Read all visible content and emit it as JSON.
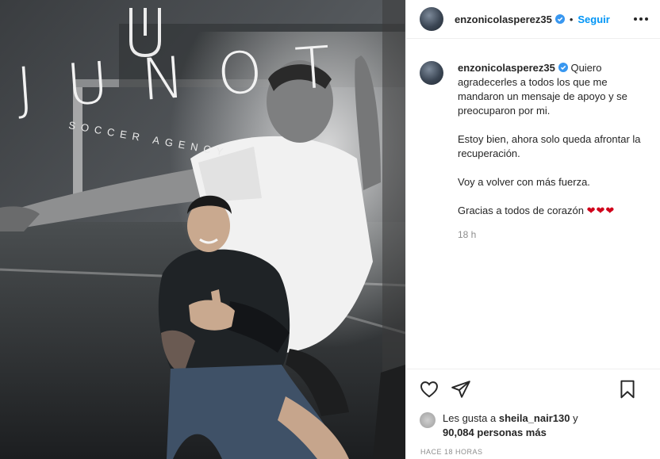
{
  "photo": {
    "logo_letters": "JUNOT",
    "logo_sub": "SOCCER AGENCY"
  },
  "header": {
    "username": "enzonicolasperez35",
    "separator": "•",
    "follow_label": "Seguir"
  },
  "caption": {
    "username": "enzonicolasperez35",
    "paragraphs": [
      "Quiero agradecerles a todos los que me mandaron un mensaje de apoyo y se preocuparon por mi.",
      "Estoy bien, ahora solo queda afrontar la recuperación.",
      "Voy a volver con más fuerza.",
      "Gracias a todos de corazón"
    ],
    "hearts": "❤❤❤",
    "time": "18 h"
  },
  "likes": {
    "prefix": "Les gusta a",
    "liker": "sheila_nair130",
    "conjunction": "y",
    "count": "90,084 personas más"
  },
  "timestamp": "HACE 18 HORAS",
  "colors": {
    "accent": "#0095f6",
    "verified": "#3897f0",
    "heart": "#d0021b",
    "muted": "#8e8e8e"
  },
  "icons": [
    "verified-badge-icon",
    "more-options-icon",
    "heart-icon",
    "share-icon",
    "bookmark-icon"
  ]
}
